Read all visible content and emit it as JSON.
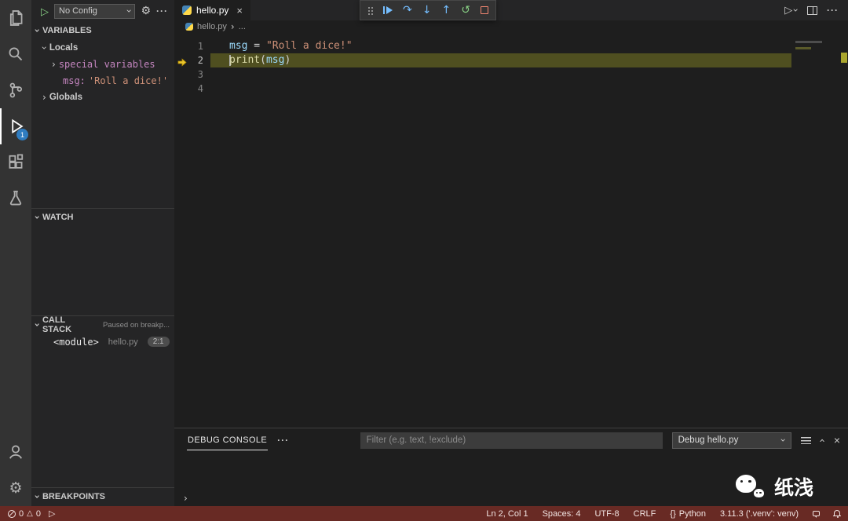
{
  "activity_bar": {
    "debug_badge": "1"
  },
  "sidebar": {
    "toolbar": {
      "config": "No Config"
    },
    "variables": {
      "title": "VARIABLES",
      "locals": "Locals",
      "special_group": "special variables",
      "var_name": "msg:",
      "var_value": "'Roll a dice!'",
      "globals": "Globals"
    },
    "watch": {
      "title": "WATCH"
    },
    "call_stack": {
      "title": "CALL STACK",
      "status": "Paused on breakp...",
      "frame": "<module>",
      "file": "hello.py",
      "position": "2:1"
    },
    "breakpoints": {
      "title": "BREAKPOINTS"
    }
  },
  "editor": {
    "tab": "hello.py",
    "breadcrumb": {
      "file": "hello.py",
      "more": "..."
    },
    "lines": {
      "l1": {
        "num": "1",
        "var": "msg",
        "op": " = ",
        "str": "\"Roll a dice!\""
      },
      "l2": {
        "num": "2",
        "fn": "print",
        "open": "(",
        "arg": "msg",
        "close": ")"
      },
      "l3": {
        "num": "3"
      },
      "l4": {
        "num": "4"
      }
    }
  },
  "panel": {
    "tab": "DEBUG CONSOLE",
    "filter_placeholder": "Filter (e.g. text, !exclude)",
    "session": "Debug hello.py"
  },
  "status_bar": {
    "errors": "0",
    "warnings": "0",
    "cursor": "Ln 2, Col 1",
    "indent": "Spaces: 4",
    "encoding": "UTF-8",
    "eol": "CRLF",
    "braces": "{}",
    "language": "Python",
    "interpreter": "3.11.3 ('.venv': venv)"
  },
  "watermark": {
    "text": "纸浅"
  },
  "colors": {
    "status_debugging_bg": "#682a24",
    "current_line_highlight": "#4f4f20",
    "badge_blue": "#2f7cc0",
    "string_orange": "#ce9178",
    "variable_blue": "#9cdcfe",
    "debug_name_pink": "#c586c0",
    "function_yellow": "#dcdcaa"
  }
}
